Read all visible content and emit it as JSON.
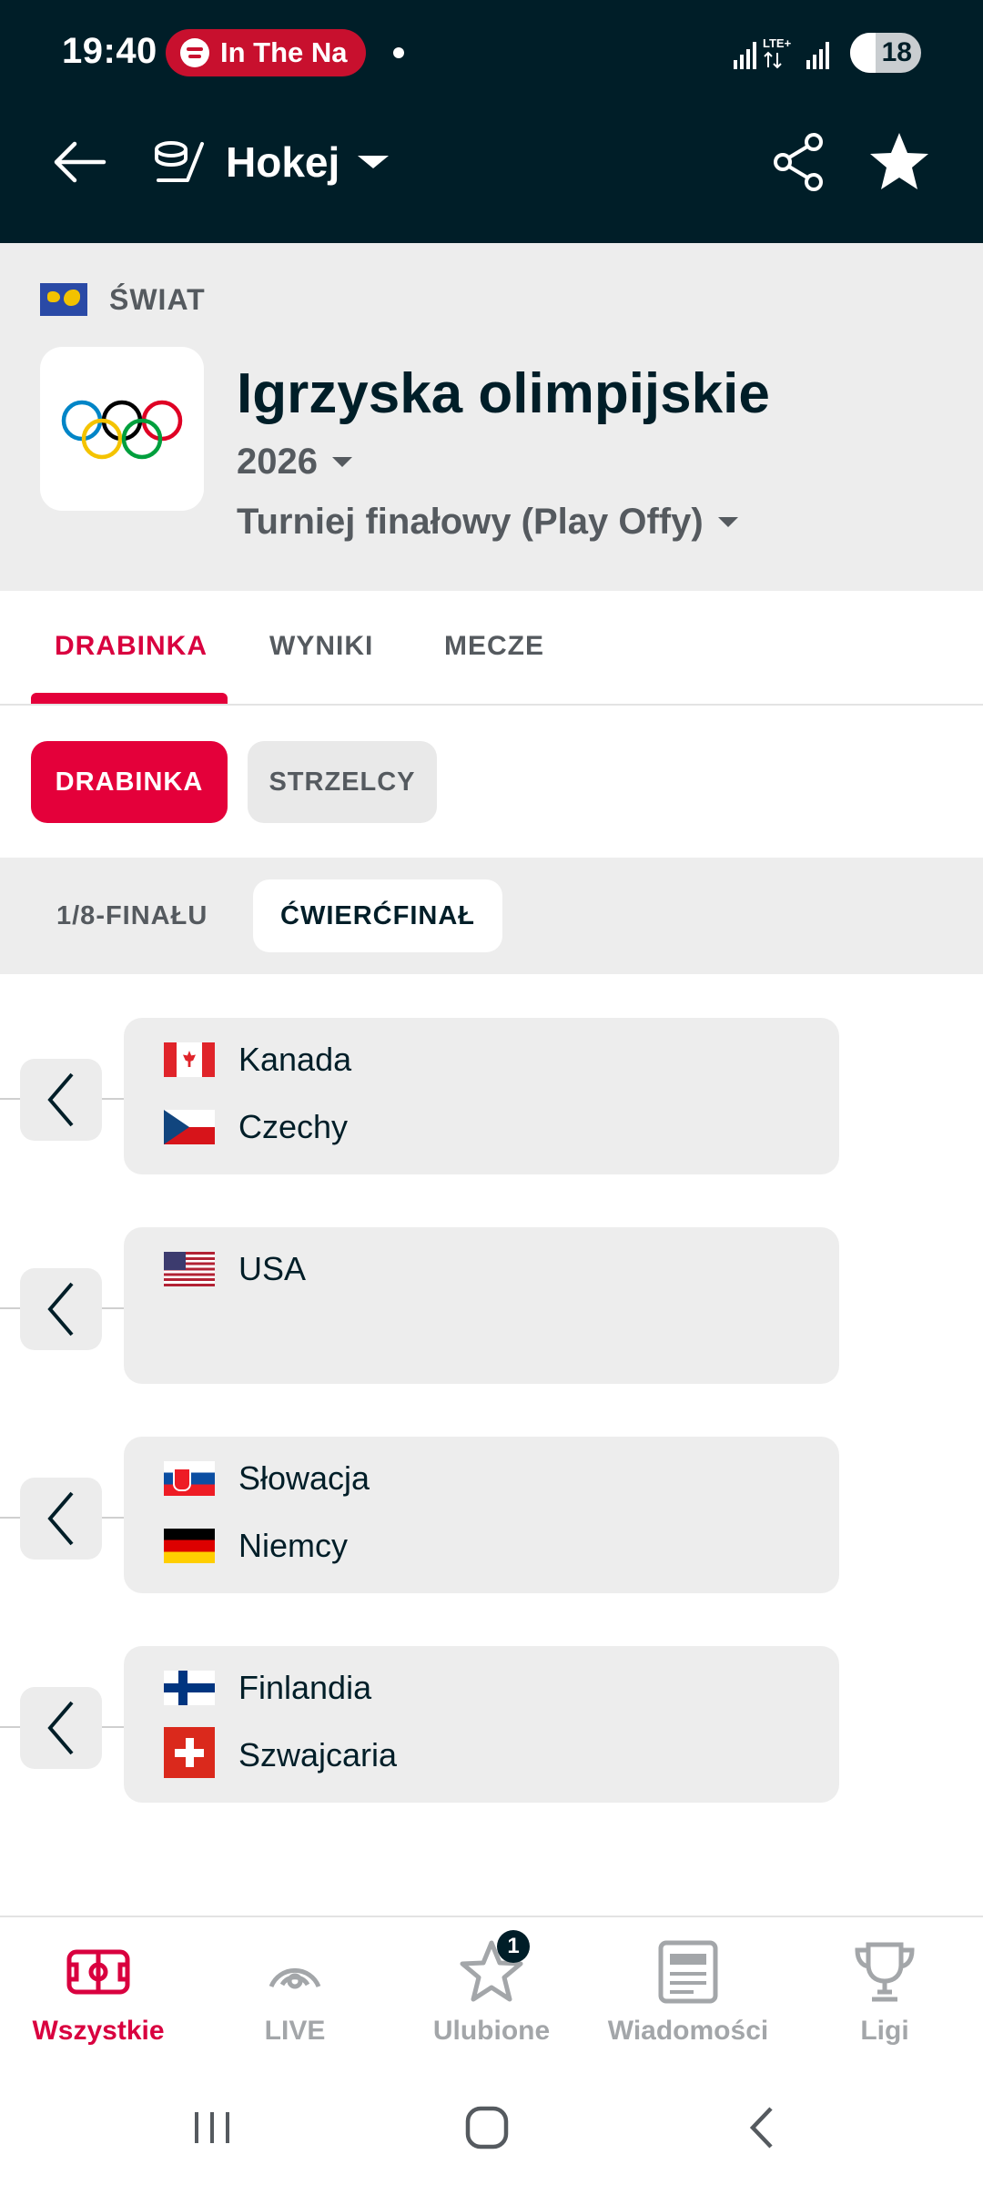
{
  "status_bar": {
    "time": "19:40",
    "media_pill": "In The Na",
    "battery": "18",
    "accent_color": "#c8102e"
  },
  "app_bar": {
    "sport": "Hokej",
    "icons": [
      "back-arrow-icon",
      "hockey-icon",
      "share-icon",
      "star-icon"
    ]
  },
  "league": {
    "country": "ŚWIAT",
    "name": "Igrzyska olimpijskie",
    "season": "2026",
    "stage": "Turniej finałowy (Play Offy)"
  },
  "tabs": [
    {
      "label": "DRABINKA",
      "active": true
    },
    {
      "label": "WYNIKI",
      "active": false
    },
    {
      "label": "MECZE",
      "active": false
    }
  ],
  "subtabs": [
    {
      "label": "DRABINKA",
      "active": true
    },
    {
      "label": "STRZELCY",
      "active": false
    }
  ],
  "rounds": [
    {
      "label": "1/8-FINAŁU",
      "active": false
    },
    {
      "label": "ĆWIERĆFINAŁ",
      "active": true
    }
  ],
  "bracket": [
    {
      "home": "Kanada",
      "away": "Czechy"
    },
    {
      "home": "USA",
      "away": ""
    },
    {
      "home": "Słowacja",
      "away": "Niemcy"
    },
    {
      "home": "Finlandia",
      "away": "Szwajcaria"
    }
  ],
  "bottom_nav": [
    {
      "label": "Wszystkie",
      "icon": "field-icon",
      "active": true
    },
    {
      "label": "LIVE",
      "icon": "live-icon",
      "active": false
    },
    {
      "label": "Ulubione",
      "icon": "star-outline-icon",
      "active": false,
      "badge": "1"
    },
    {
      "label": "Wiadomości",
      "icon": "news-icon",
      "active": false
    },
    {
      "label": "Ligi",
      "icon": "trophy-icon",
      "active": false
    }
  ],
  "colors": {
    "primary_dark": "#001e28",
    "accent_red": "#e4003a",
    "surface_gray": "#ededed"
  }
}
